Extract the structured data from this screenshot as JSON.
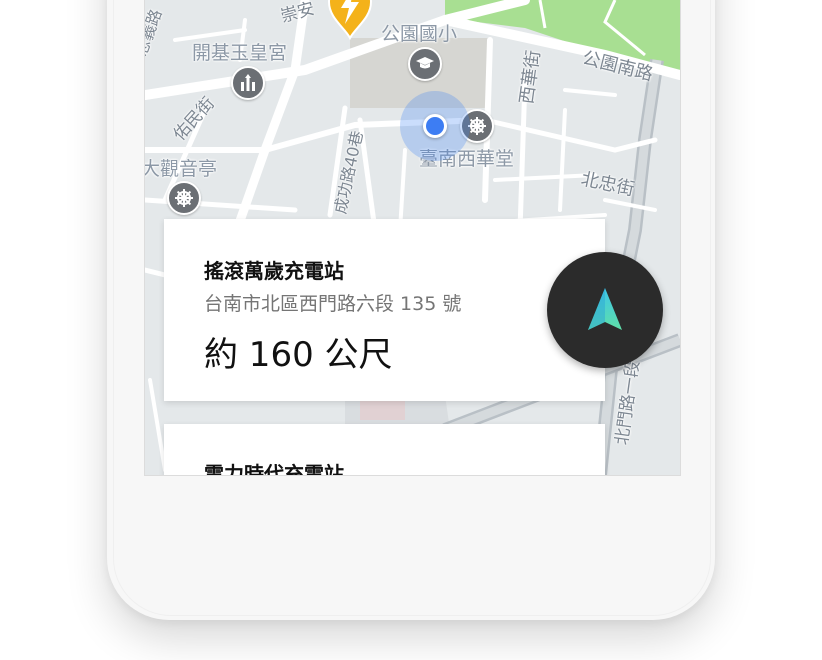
{
  "map": {
    "labels": {
      "chongan": "崇安",
      "kaiji": "開基玉皇宮",
      "school": "公園國小",
      "park_south_road": "公園南路",
      "xihua_street": "西華街",
      "youmin_street": "佑民街",
      "daguanyin": "大觀音亭",
      "xihua_church": "臺南西華堂",
      "beizhong_street": "北忠街",
      "chenggong_lane": "成功路40巷",
      "ximen_road": "北門路一段",
      "left_edge_road": "忠義路"
    },
    "icons": {
      "school_poi": "graduation-cap-icon",
      "temple_poi": "temple-icon",
      "church_poi": "dharma-wheel-icon",
      "location": "current-location-dot",
      "charger_pin": "lightning-pin-icon"
    },
    "colors": {
      "land": "#e4e8ea",
      "road": "#ffffff",
      "park": "#a8df92",
      "pin": "#f4b21a",
      "location": "#3d7df3"
    }
  },
  "stations": [
    {
      "name": "搖滾萬歲充電站",
      "address": "台南市北區西門路六段 135 號",
      "distance": "約 160 公尺"
    },
    {
      "name": "電力時代充電站"
    }
  ],
  "navigate_button": {
    "icon": "navigation-arrow-icon",
    "colors": {
      "background": "#2b2b2b",
      "arrow_top": "#3ec5e8",
      "arrow_bottom": "#5fe0a8"
    }
  }
}
